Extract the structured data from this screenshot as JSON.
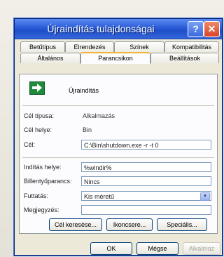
{
  "window": {
    "title": "Újraindítás tulajdonságai",
    "help": "?",
    "close": "✕"
  },
  "tabs_row1": [
    "Betűtípus",
    "Elrendezés",
    "Színek",
    "Kompatibilitás"
  ],
  "tabs_row2": [
    "Általános",
    "Parancsikon",
    "Beállítások"
  ],
  "active_tab": "Parancsikon",
  "program": {
    "name": "Újraindítás",
    "icon": "green-arrow-icon"
  },
  "fields": {
    "target_type_label": "Cél típusa:",
    "target_type_value": "Alkalmazás",
    "target_location_label": "Cél helye:",
    "target_location_value": "Bin",
    "target_label": "Cél:",
    "target_value": "C:\\Bin\\shutdown.exe -r -t 0",
    "start_in_label": "Indítás helye:",
    "start_in_value": "%windir%",
    "hotkey_label": "Billentyűparancs:",
    "hotkey_value": "Nincs",
    "run_label": "Futtatás:",
    "run_value": "Kis méretű",
    "comment_label": "Megjegyzés:",
    "comment_value": ""
  },
  "panel_buttons": {
    "find_target": "Cél keresése...",
    "change_icon": "Ikoncsere...",
    "advanced": "Speciális..."
  },
  "dialog_buttons": {
    "ok": "OK",
    "cancel": "Mégse",
    "apply": "Alkalmaz"
  }
}
